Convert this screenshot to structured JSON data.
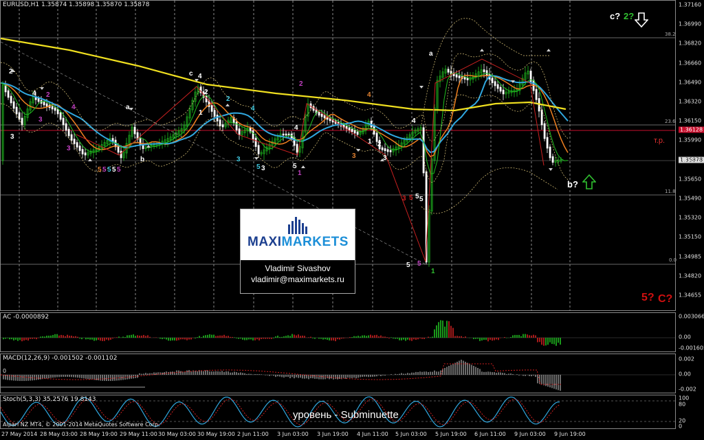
{
  "chart_window": {
    "symbol_header": "EURUSD,H1  1.35874 1.35898 1.35870 1.35878",
    "price_scale": [
      "1.37160",
      "1.36990",
      "1.36820",
      "1.36660",
      "1.36490",
      "1.36320",
      "1.36150",
      "1.35990",
      "1.35825",
      "1.35650",
      "1.35490",
      "1.35320",
      "1.35150",
      "1.34985",
      "1.34820",
      "1.34655"
    ],
    "highlight_price": "1.36128",
    "current_price": "1.35878",
    "fib_levels": [
      "38.2",
      "23.6",
      "11.8",
      "0.0"
    ],
    "target_label": "т.р.",
    "annotation_top": {
      "c": "c?",
      "two": "2?"
    },
    "annotation_b": "b?",
    "annotation_bottom": {
      "five": "5?",
      "c": "C?"
    }
  },
  "ac_window": {
    "title": "AC -0.0000892",
    "scale": [
      "0.003066",
      "0.00",
      "-0.001605"
    ]
  },
  "macd_window": {
    "title": "MACD(12,26,9) -0.001502 -0.001102",
    "scale": [
      "0.002",
      "0.00",
      "-0.002"
    ],
    "zero_label": "0"
  },
  "stoch_window": {
    "title": "Stoch(5,3,3) 35.2576 19.8143",
    "scale": [
      "100",
      "80",
      "20",
      "0"
    ],
    "copyright": "Alpari NZ MT4, © 2001-2014 MetaQuotes Software Corp.",
    "subtitle": "уровень - Subminuette"
  },
  "time_axis": [
    "27 May 2014",
    "28 May 03:00",
    "28 May 19:00",
    "29 May 11:00",
    "30 May 03:00",
    "30 May 19:00",
    "2 Jun 11:00",
    "3 Jun 03:00",
    "3 Jun 19:00",
    "4 Jun 11:00",
    "5 Jun 03:00",
    "5 Jun 19:00",
    "6 Jun 11:00",
    "9 Jun 03:00",
    "9 Jun 19:00"
  ],
  "wave_labels": [
    {
      "t": "2",
      "c": "#ffffff"
    },
    {
      "t": "4",
      "c": "#ffffff"
    },
    {
      "t": "2",
      "c": "#c040c0"
    },
    {
      "t": "3",
      "c": "#c040c0"
    },
    {
      "t": "4",
      "c": "#c040c0"
    },
    {
      "t": "3",
      "c": "#ffffff"
    },
    {
      "t": "3",
      "c": "#c040c0"
    },
    {
      "t": "a",
      "c": "#ffffff"
    },
    {
      "t": "c",
      "c": "#ffffff"
    },
    {
      "t": "4",
      "c": "#ffffff"
    },
    {
      "t": "2",
      "c": "#ffffff"
    },
    {
      "t": "1",
      "c": "#ffffff"
    },
    {
      "t": "2",
      "c": "#40c8e0"
    },
    {
      "t": "4",
      "c": "#40c8e0"
    },
    {
      "t": "3",
      "c": "#40c8e0"
    },
    {
      "t": "5",
      "c": "#40c8e0"
    },
    {
      "t": "3",
      "c": "#ffffff"
    },
    {
      "t": "2",
      "c": "#c040c0"
    },
    {
      "t": "4",
      "c": "#ffffff"
    },
    {
      "t": "5",
      "c": "#ffffff"
    },
    {
      "t": "1",
      "c": "#c040c0"
    },
    {
      "t": "4",
      "c": "#e08030"
    },
    {
      "t": "3",
      "c": "#e08030"
    },
    {
      "t": "1",
      "c": "#ffffff"
    },
    {
      "t": "2",
      "c": "#ffffff"
    },
    {
      "t": "3",
      "c": "#ffffff"
    },
    {
      "t": "4",
      "c": "#ffffff"
    },
    {
      "t": "a",
      "c": "#ffffff"
    },
    {
      "t": "5",
      "c": "#ffffff"
    },
    {
      "t": "1",
      "c": "#30c030"
    },
    {
      "t": "b",
      "c": "#ffffff"
    },
    {
      "t": "3",
      "c": "#c82020"
    },
    {
      "t": "5",
      "c": "#c82020"
    },
    {
      "t": "5",
      "c": "#ffffff"
    },
    {
      "t": "5",
      "c": "#ffffff"
    },
    {
      "t": "5",
      "c": "#c040c0"
    }
  ],
  "colors": {
    "ma_yellow": "#f0e020",
    "ma_blue": "#30a8e0",
    "ma_orange": "#f08020",
    "ma_green": "#20c020",
    "bull_candle": "#20c020",
    "bear_candle": "#ffffff",
    "highlight_line": "#c8102e",
    "arrow_green": "#30c030"
  },
  "watermark": {
    "brand_left": "MAXI",
    "brand_right": "MARKETS",
    "name": "Vladimir Sivashov",
    "email": "vladimir@maximarkets.ru"
  }
}
